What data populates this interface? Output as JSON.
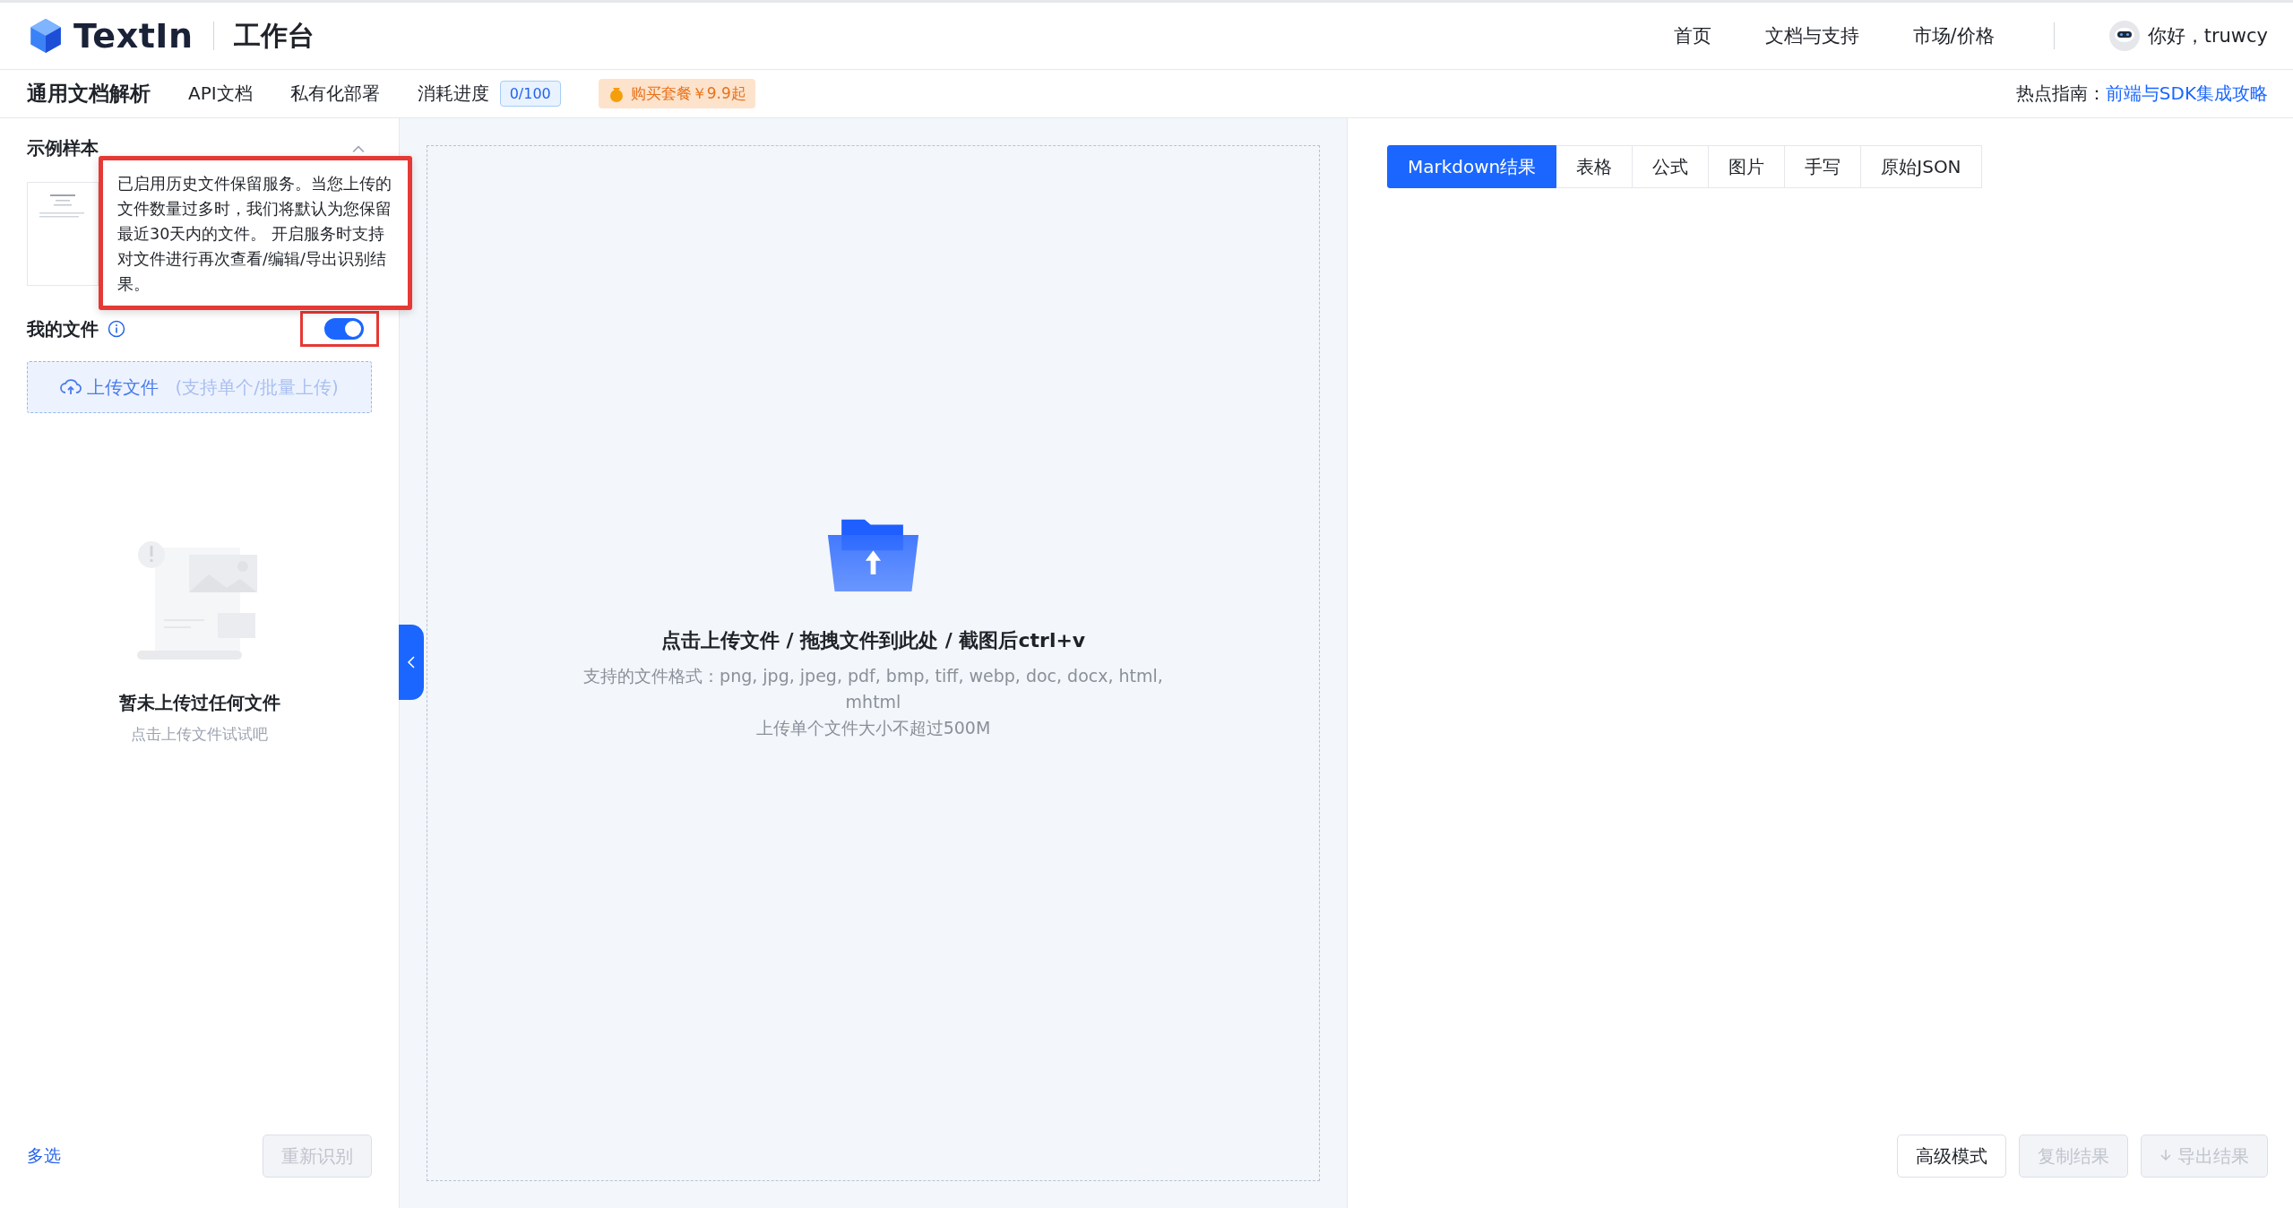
{
  "header": {
    "logo_text": "TextIn",
    "title": "工作台",
    "nav": [
      "首页",
      "文档与支持",
      "市场/价格"
    ],
    "greeting": "你好，truwcy"
  },
  "subnav": {
    "title": "通用文档解析",
    "links": [
      "API文档",
      "私有化部署"
    ],
    "usage_label": "消耗进度",
    "usage_badge": "0/100",
    "promo": "购买套餐￥9.9起",
    "hot_label": "热点指南：",
    "hot_link": "前端与SDK集成攻略"
  },
  "left_panel": {
    "samples": {
      "title": "示例样本",
      "expanded": true
    },
    "tooltip": "已启用历史文件保留服务。当您上传的文件数量过多时，我们将默认为您保留最近30天内的文件。 开启服务时支持对文件进行再次查看/编辑/导出识别结果。",
    "my_files": {
      "title": "我的文件",
      "retention_on": true
    },
    "upload_button": {
      "label": "上传文件",
      "hint": "(支持单个/批量上传)"
    },
    "empty_state": {
      "title": "暂未上传过任何文件",
      "subtitle": "点击上传文件试试吧"
    },
    "footer": {
      "multi_select": "多选",
      "rerecognize": {
        "label": "重新识别",
        "disabled": true
      }
    }
  },
  "dropzone": {
    "title": "点击上传文件 / 拖拽文件到此处 / 截图后ctrl+v",
    "formats": "支持的文件格式：png, jpg, jpeg, pdf, bmp, tiff, webp, doc, docx, html, mhtml",
    "limit": "上传单个文件大小不超过500M"
  },
  "result_panel": {
    "tabs": [
      {
        "label": "Markdown结果",
        "selected": true
      },
      {
        "label": "表格",
        "selected": false
      },
      {
        "label": "公式",
        "selected": false
      },
      {
        "label": "图片",
        "selected": false
      },
      {
        "label": "手写",
        "selected": false
      },
      {
        "label": "原始JSON",
        "selected": false
      }
    ],
    "buttons": [
      {
        "label": "高级模式",
        "disabled": false,
        "kind": "plain"
      },
      {
        "label": "复制结果",
        "disabled": true,
        "kind": "plain"
      },
      {
        "label": "导出结果",
        "disabled": true,
        "kind": "download"
      }
    ]
  }
}
